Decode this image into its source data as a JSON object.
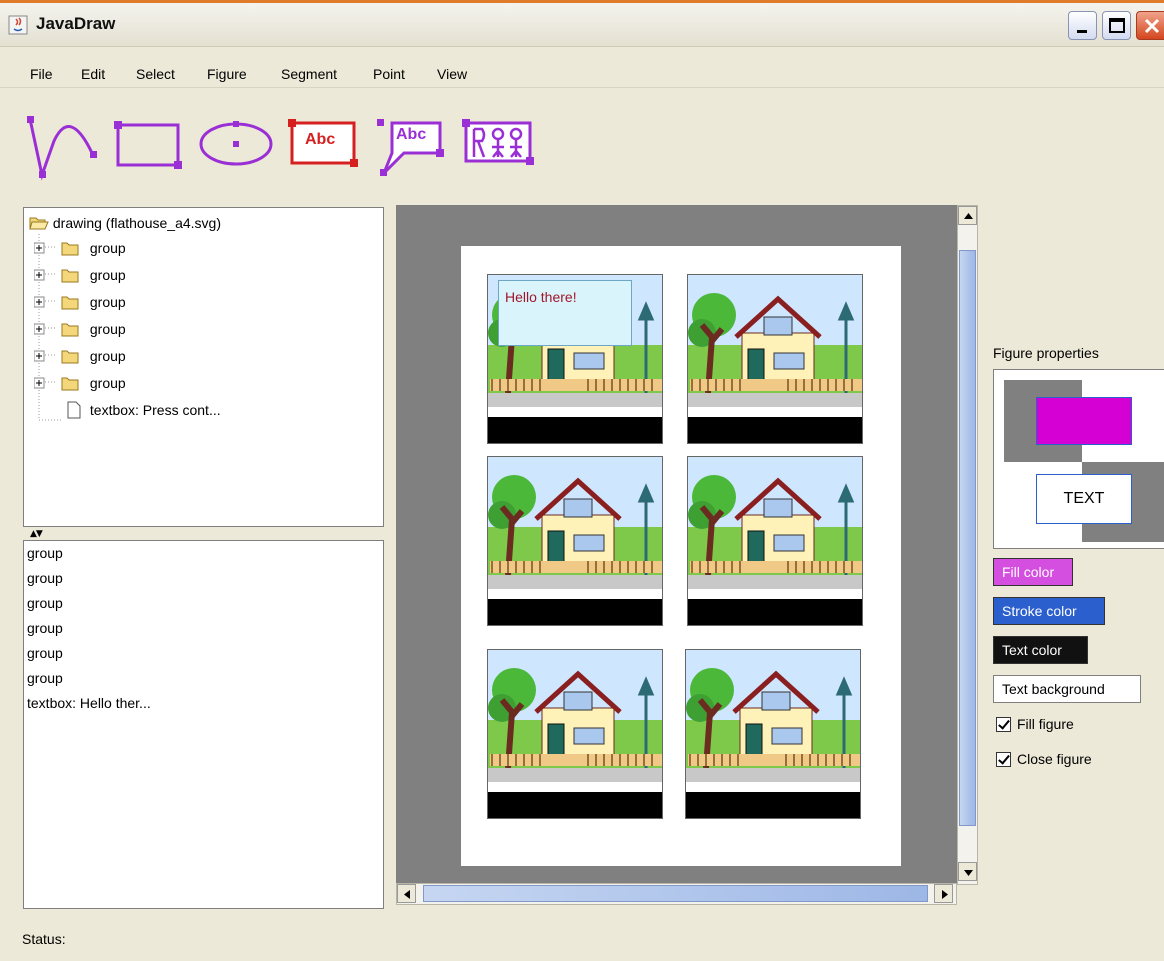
{
  "window": {
    "title": "JavaDraw"
  },
  "menu": [
    "File",
    "Edit",
    "Select",
    "Figure",
    "Segment",
    "Point",
    "View"
  ],
  "toolbar": {
    "tools": [
      {
        "name": "curve-tool-icon"
      },
      {
        "name": "rectangle-tool-icon"
      },
      {
        "name": "ellipse-tool-icon"
      },
      {
        "name": "textbox-tool-icon",
        "label": "Abc"
      },
      {
        "name": "callout-tool-icon",
        "label": "Abc"
      },
      {
        "name": "image-tool-icon"
      }
    ],
    "purple": "#9b2fd6",
    "red": "#d61f1f"
  },
  "tree": {
    "root": "drawing (flathouse_a4.svg)",
    "items": [
      "group",
      "group",
      "group",
      "group",
      "group",
      "group"
    ],
    "leaf": "textbox: Press cont..."
  },
  "list": {
    "items": [
      "group",
      "group",
      "group",
      "group",
      "group",
      "group",
      "textbox: Hello ther..."
    ]
  },
  "canvas": {
    "textbox_text": "Hello there!"
  },
  "properties": {
    "label": "Figure properties",
    "preview_text": "TEXT",
    "fill_color_label": "Fill color",
    "stroke_color_label": "Stroke color",
    "text_color_label": "Text color",
    "text_background_label": "Text background",
    "fill_figure_label": "Fill figure",
    "close_figure_label": "Close figure",
    "fill_figure_checked": true,
    "close_figure_checked": true,
    "fill_color": "#d400d4",
    "stroke_color": "#2b5fce"
  },
  "status": {
    "label": "Status:"
  }
}
